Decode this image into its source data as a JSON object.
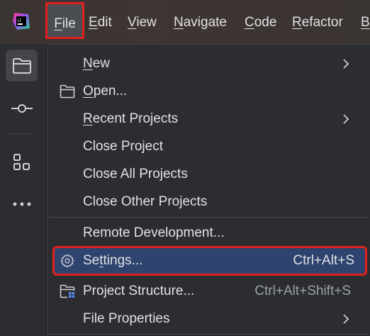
{
  "menubar": {
    "app_icon": "jetbrains-ide-logo",
    "items": [
      {
        "pre": "",
        "mnemonic": "F",
        "post": "ile"
      },
      {
        "pre": "",
        "mnemonic": "E",
        "post": "dit"
      },
      {
        "pre": "",
        "mnemonic": "V",
        "post": "iew"
      },
      {
        "pre": "",
        "mnemonic": "N",
        "post": "avigate"
      },
      {
        "pre": "",
        "mnemonic": "C",
        "post": "ode"
      },
      {
        "pre": "",
        "mnemonic": "R",
        "post": "efactor"
      },
      {
        "pre": "",
        "mnemonic": "B",
        "post": ""
      }
    ]
  },
  "toolstrip": {
    "buttons": [
      "folder-icon",
      "commit-icon",
      "structure-icon",
      "more-icon"
    ]
  },
  "file_menu": {
    "items": [
      {
        "pre": "",
        "mnemonic": "N",
        "post": "ew",
        "shortcut": "",
        "submenu": true,
        "icon": ""
      },
      {
        "pre": "",
        "mnemonic": "O",
        "post": "pen...",
        "shortcut": "",
        "submenu": false,
        "icon": "folder-icon"
      },
      {
        "pre": "",
        "mnemonic": "R",
        "post": "ecent Projects",
        "shortcut": "",
        "submenu": true,
        "icon": ""
      },
      {
        "pre": "Close Pro",
        "mnemonic": "j",
        "post": "ect",
        "shortcut": "",
        "submenu": false,
        "icon": ""
      },
      {
        "pre": "Close All Projects",
        "mnemonic": "",
        "post": "",
        "shortcut": "",
        "submenu": false,
        "icon": ""
      },
      {
        "pre": "Close Other Projects",
        "mnemonic": "",
        "post": "",
        "shortcut": "",
        "submenu": false,
        "icon": ""
      },
      {
        "pre": "Remote Development...",
        "mnemonic": "",
        "post": "",
        "shortcut": "",
        "submenu": false,
        "icon": ""
      },
      {
        "pre": "Se",
        "mnemonic": "t",
        "post": "tings...",
        "shortcut": "Ctrl+Alt+S",
        "submenu": false,
        "icon": "gear-icon",
        "selected": true
      },
      {
        "pre": "Project Structure...",
        "mnemonic": "",
        "post": "",
        "shortcut": "Ctrl+Alt+Shift+S",
        "submenu": false,
        "icon": "project-structure-icon"
      },
      {
        "pre": "File Properties",
        "mnemonic": "",
        "post": "",
        "shortcut": "",
        "submenu": true,
        "icon": ""
      }
    ]
  },
  "colors": {
    "menu_bg": "#2b2d30",
    "selection": "#2e436e",
    "highlight_border": "#e0211d",
    "text": "#dfe1e5"
  }
}
